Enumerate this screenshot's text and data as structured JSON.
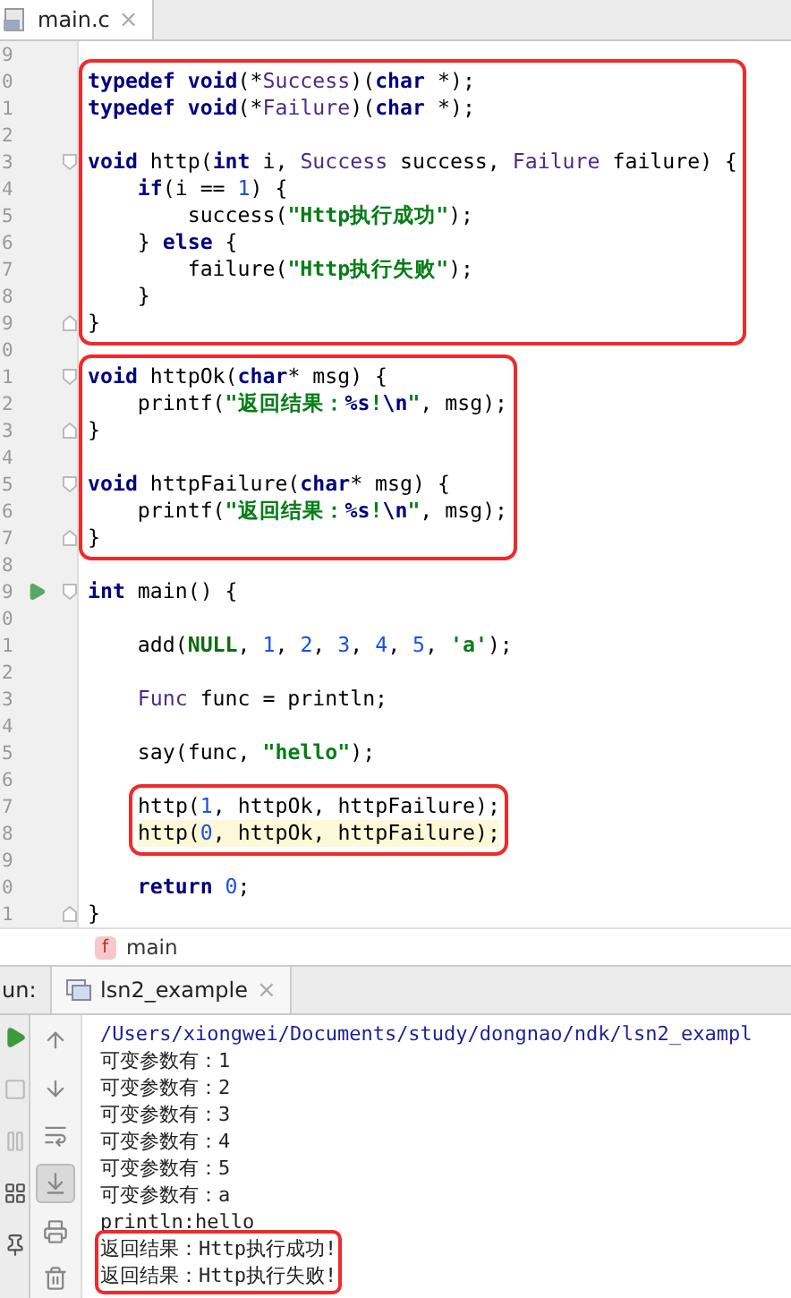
{
  "editor_tab": {
    "label": "main.c",
    "close": "×",
    "selected": true
  },
  "code": [
    {
      "boxed": false,
      "indented": false,
      "lines": [
        {
          "number": "9"
        }
      ]
    },
    {
      "boxed": true,
      "indented": false,
      "lines": [
        {
          "number": "0",
          "tokens": [
            {
              "t": "typedef ",
              "kind": "kw"
            },
            {
              "t": "void",
              "kind": "kw"
            },
            {
              "t": "(*",
              "kind": "plain"
            },
            {
              "t": "Success",
              "kind": "type"
            },
            {
              "t": ")(",
              "kind": "plain"
            },
            {
              "t": "char",
              "kind": "kw"
            },
            {
              "t": " *);",
              "kind": "plain"
            }
          ]
        },
        {
          "number": "1",
          "tokens": [
            {
              "t": "typedef ",
              "kind": "kw"
            },
            {
              "t": "void",
              "kind": "kw"
            },
            {
              "t": "(*",
              "kind": "plain"
            },
            {
              "t": "Failure",
              "kind": "type"
            },
            {
              "t": ")(",
              "kind": "plain"
            },
            {
              "t": "char",
              "kind": "kw"
            },
            {
              "t": " *);",
              "kind": "plain"
            }
          ]
        },
        {
          "number": "2"
        },
        {
          "number": "3",
          "fold_start": true,
          "tokens": [
            {
              "t": "void",
              "kind": "kw"
            },
            {
              "t": " http(",
              "kind": "plain"
            },
            {
              "t": "int",
              "kind": "kw"
            },
            {
              "t": " i, ",
              "kind": "plain"
            },
            {
              "t": "Success",
              "kind": "type"
            },
            {
              "t": " success, ",
              "kind": "plain"
            },
            {
              "t": "Failure",
              "kind": "type"
            },
            {
              "t": " failure) {",
              "kind": "plain"
            }
          ]
        },
        {
          "number": "4",
          "tokens": [
            {
              "t": "    if",
              "kind": "kw"
            },
            {
              "t": "(i == ",
              "kind": "plain"
            },
            {
              "t": "1",
              "kind": "num"
            },
            {
              "t": ") {",
              "kind": "plain"
            }
          ]
        },
        {
          "number": "5",
          "tokens": [
            {
              "t": "        success(",
              "kind": "plain"
            },
            {
              "t": "\"Http执行成功\"",
              "kind": "str"
            },
            {
              "t": ");",
              "kind": "plain"
            }
          ]
        },
        {
          "number": "6",
          "tokens": [
            {
              "t": "    } ",
              "kind": "plain"
            },
            {
              "t": "else",
              "kind": "kw"
            },
            {
              "t": " {",
              "kind": "plain"
            }
          ]
        },
        {
          "number": "7",
          "tokens": [
            {
              "t": "        failure(",
              "kind": "plain"
            },
            {
              "t": "\"Http执行失败\"",
              "kind": "str"
            },
            {
              "t": ");",
              "kind": "plain"
            }
          ]
        },
        {
          "number": "8",
          "tokens": [
            {
              "t": "    }",
              "kind": "plain"
            }
          ]
        },
        {
          "number": "9",
          "fold_end": true,
          "tokens": [
            {
              "t": "}",
              "kind": "plain"
            }
          ]
        }
      ]
    },
    {
      "boxed": false,
      "indented": false,
      "lines": [
        {
          "number": "0"
        }
      ]
    },
    {
      "boxed": true,
      "indented": false,
      "lines": [
        {
          "number": "1",
          "fold_start": true,
          "tokens": [
            {
              "t": "void",
              "kind": "kw"
            },
            {
              "t": " httpOk(",
              "kind": "plain"
            },
            {
              "t": "char",
              "kind": "kw"
            },
            {
              "t": "* msg) {",
              "kind": "plain"
            }
          ]
        },
        {
          "number": "2",
          "tokens": [
            {
              "t": "    printf(",
              "kind": "plain"
            },
            {
              "t": "\"返回结果：",
              "kind": "str"
            },
            {
              "t": "%s",
              "kind": "esc"
            },
            {
              "t": "!",
              "kind": "str"
            },
            {
              "t": "\\n",
              "kind": "esc"
            },
            {
              "t": "\"",
              "kind": "str"
            },
            {
              "t": ", msg);",
              "kind": "plain"
            }
          ]
        },
        {
          "number": "3",
          "fold_end": true,
          "tokens": [
            {
              "t": "}",
              "kind": "plain"
            }
          ]
        },
        {
          "number": "4"
        },
        {
          "number": "5",
          "fold_start": true,
          "tokens": [
            {
              "t": "void",
              "kind": "kw"
            },
            {
              "t": " httpFailure(",
              "kind": "plain"
            },
            {
              "t": "char",
              "kind": "kw"
            },
            {
              "t": "* msg) {",
              "kind": "plain"
            }
          ]
        },
        {
          "number": "6",
          "tokens": [
            {
              "t": "    printf(",
              "kind": "plain"
            },
            {
              "t": "\"返回结果：",
              "kind": "str"
            },
            {
              "t": "%s",
              "kind": "esc"
            },
            {
              "t": "!",
              "kind": "str"
            },
            {
              "t": "\\n",
              "kind": "esc"
            },
            {
              "t": "\"",
              "kind": "str"
            },
            {
              "t": ", msg);",
              "kind": "plain"
            }
          ]
        },
        {
          "number": "7",
          "fold_end": true,
          "tokens": [
            {
              "t": "}",
              "kind": "plain"
            }
          ]
        }
      ]
    },
    {
      "boxed": false,
      "indented": false,
      "lines": [
        {
          "number": "8"
        },
        {
          "number": "9",
          "run": true,
          "fold_start": true,
          "tokens": [
            {
              "t": "int",
              "kind": "kw"
            },
            {
              "t": " main() {",
              "kind": "plain"
            }
          ]
        },
        {
          "number": "0"
        },
        {
          "number": "1",
          "tokens": [
            {
              "t": "    add(",
              "kind": "plain"
            },
            {
              "t": "NULL",
              "kind": "macro"
            },
            {
              "t": ", ",
              "kind": "plain"
            },
            {
              "t": "1",
              "kind": "num"
            },
            {
              "t": ", ",
              "kind": "plain"
            },
            {
              "t": "2",
              "kind": "num"
            },
            {
              "t": ", ",
              "kind": "plain"
            },
            {
              "t": "3",
              "kind": "num"
            },
            {
              "t": ", ",
              "kind": "plain"
            },
            {
              "t": "4",
              "kind": "num"
            },
            {
              "t": ", ",
              "kind": "plain"
            },
            {
              "t": "5",
              "kind": "num"
            },
            {
              "t": ", ",
              "kind": "plain"
            },
            {
              "t": "'a'",
              "kind": "str"
            },
            {
              "t": ");",
              "kind": "plain"
            }
          ]
        },
        {
          "number": "2"
        },
        {
          "number": "3",
          "tokens": [
            {
              "t": "    Func",
              "kind": "type"
            },
            {
              "t": " func = println;",
              "kind": "plain"
            }
          ]
        },
        {
          "number": "4"
        },
        {
          "number": "5",
          "tokens": [
            {
              "t": "    say(func, ",
              "kind": "plain"
            },
            {
              "t": "\"hello\"",
              "kind": "str"
            },
            {
              "t": ");",
              "kind": "plain"
            }
          ]
        },
        {
          "number": "6"
        }
      ]
    },
    {
      "boxed": true,
      "indented": true,
      "lines": [
        {
          "number": "7",
          "current": false,
          "tokens": [
            {
              "t": "http(",
              "kind": "plain"
            },
            {
              "t": "1",
              "kind": "num"
            },
            {
              "t": ", httpOk, httpFailure);",
              "kind": "plain"
            }
          ]
        },
        {
          "number": "8",
          "current": true,
          "tokens": [
            {
              "t": "http(",
              "kind": "plain"
            },
            {
              "t": "0",
              "kind": "num"
            },
            {
              "t": ", httpOk, httpFailure);",
              "kind": "plain"
            }
          ]
        }
      ]
    },
    {
      "boxed": false,
      "indented": false,
      "lines": [
        {
          "number": "9"
        },
        {
          "number": "0",
          "tokens": [
            {
              "t": "    return ",
              "kind": "kw"
            },
            {
              "t": "0",
              "kind": "num"
            },
            {
              "t": ";",
              "kind": "plain"
            }
          ]
        },
        {
          "number": "1",
          "fold_end": true,
          "tokens": [
            {
              "t": "}",
              "kind": "plain"
            }
          ]
        }
      ]
    }
  ],
  "breadcrumb": {
    "badge": "f",
    "label": "main"
  },
  "run_panel": {
    "label": "un:",
    "tab": {
      "label": "lsn2_example",
      "close": "×",
      "selected": true
    },
    "left_tools": [
      {
        "kind": "run"
      },
      {
        "kind": "stop"
      },
      {
        "kind": "pause"
      },
      {
        "kind": "layout"
      },
      {
        "kind": "pin"
      }
    ],
    "tools": [
      {
        "kind": "up",
        "selected": false
      },
      {
        "kind": "down",
        "selected": false
      },
      {
        "kind": "wrap",
        "selected": false
      },
      {
        "kind": "scroll-end",
        "selected": true
      },
      {
        "kind": "print",
        "selected": false
      },
      {
        "kind": "trash",
        "selected": false
      }
    ],
    "output": [
      {
        "boxed": false,
        "lines": [
          {
            "kind": "path",
            "text": "/Users/xiongwei/Documents/study/dongnao/ndk/lsn2_exampl"
          },
          {
            "kind": "out",
            "text": "可变参数有：1"
          },
          {
            "kind": "out",
            "text": "可变参数有：2"
          },
          {
            "kind": "out",
            "text": "可变参数有：3"
          },
          {
            "kind": "out",
            "text": "可变参数有：4"
          },
          {
            "kind": "out",
            "text": "可变参数有：5"
          },
          {
            "kind": "out",
            "text": "可变参数有：a"
          },
          {
            "kind": "out",
            "text": "println:hello"
          }
        ]
      },
      {
        "boxed": true,
        "lines": [
          {
            "kind": "out",
            "text": "返回结果：Http执行成功!"
          },
          {
            "kind": "out",
            "text": "返回结果：Http执行失败!"
          }
        ]
      }
    ]
  }
}
